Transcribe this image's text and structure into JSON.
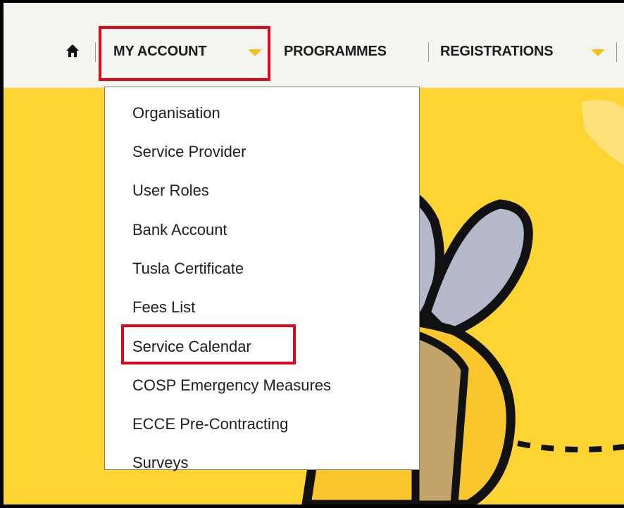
{
  "nav": {
    "home_icon": "home-icon",
    "my_account": "MY ACCOUNT",
    "programmes": "PROGRAMMES",
    "registrations": "REGISTRATIONS",
    "caret_color": "#f2c21b",
    "highlight_color": "#e3051b"
  },
  "menu": {
    "items": [
      {
        "label": "Organisation"
      },
      {
        "label": "Service Provider"
      },
      {
        "label": "User Roles"
      },
      {
        "label": "Bank Account"
      },
      {
        "label": "Tusla Certificate"
      },
      {
        "label": "Fees List"
      },
      {
        "label": "Service Calendar"
      },
      {
        "label": "COSP Emergency Measures"
      },
      {
        "label": "ECCE Pre-Contracting"
      },
      {
        "label": "Surveys"
      }
    ]
  },
  "hero": {
    "background_color": "#fdd432",
    "illustration": "bee-illustration"
  }
}
